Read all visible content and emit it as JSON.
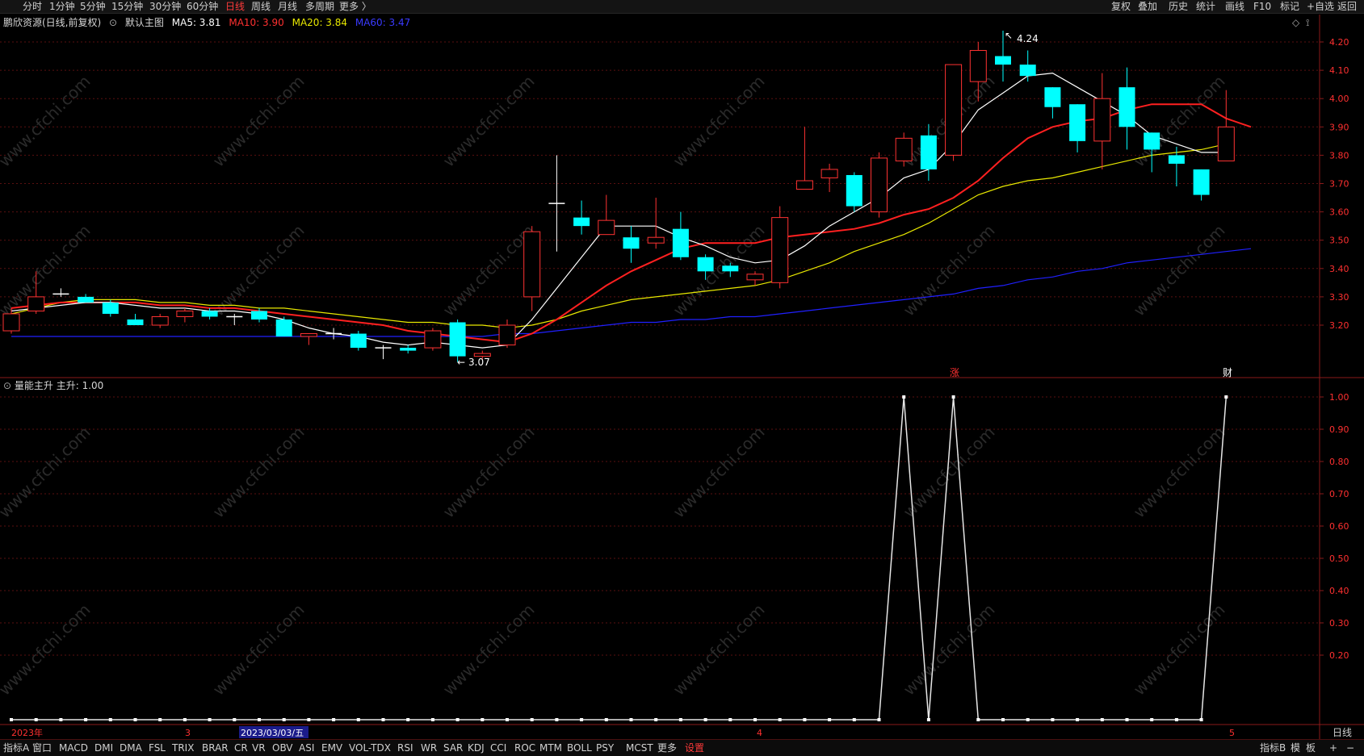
{
  "toolbar": {
    "periods": [
      "分时",
      "1分钟",
      "5分钟",
      "15分钟",
      "30分钟",
      "60分钟",
      "日线",
      "周线",
      "月线",
      "多周期",
      "更多 〉"
    ],
    "active_period": "日线",
    "right_items": [
      "复权",
      "叠加",
      "历史",
      "统计",
      "画线",
      "F10",
      "标记",
      "+自选",
      "返回"
    ]
  },
  "main_legend": {
    "title": "鹏欣资源(日线,前复权)",
    "template": "默认主图",
    "ma5": "MA5: 3.81",
    "ma10": "MA10: 3.90",
    "ma20": "MA20: 3.84",
    "ma60": "MA60: 3.47"
  },
  "sub_legend": {
    "name": "量能主升",
    "value": "主升: 1.00"
  },
  "markers": {
    "high_label": "4.24",
    "low_label": "3.07",
    "zhang": "涨",
    "cai": "财"
  },
  "x_axis": {
    "year_label": "2023年",
    "m3": "3",
    "date_cursor": "2023/03/03/五",
    "m4": "4",
    "m5": "5",
    "period": "日线"
  },
  "bottom_tabs": [
    "指标A",
    "窗口",
    "MACD",
    "DMI",
    "DMA",
    "FSL",
    "TRIX",
    "BRAR",
    "CR",
    "VR",
    "OBV",
    "ASI",
    "EMV",
    "VOL-TDX",
    "RSI",
    "WR",
    "SAR",
    "KDJ",
    "CCI",
    "ROC",
    "MTM",
    "BOLL",
    "PSY",
    "MCST",
    "更多",
    "设置"
  ],
  "bottom_right": [
    "指标B",
    "模",
    "板",
    "+",
    "−"
  ],
  "watermark": "www.cfchi.com",
  "colors": {
    "up": "#ff3232",
    "down": "#00ffff",
    "ma5": "#ffffff",
    "ma10": "#ff2020",
    "ma20": "#e8e800",
    "ma60": "#2020ff",
    "grid": "#5a1010"
  },
  "chart_data": [
    {
      "type": "candlestick",
      "title": "鹏欣资源(日线,前复权)",
      "ylim": [
        3.07,
        4.24
      ],
      "yticks": [
        3.2,
        3.3,
        3.4,
        3.5,
        3.6,
        3.7,
        3.8,
        3.9,
        4.0,
        4.1,
        4.2
      ],
      "candles": [
        {
          "o": 3.18,
          "h": 3.26,
          "l": 3.17,
          "c": 3.24
        },
        {
          "o": 3.25,
          "h": 3.39,
          "l": 3.24,
          "c": 3.3
        },
        {
          "o": 3.31,
          "h": 3.33,
          "l": 3.3,
          "c": 3.31
        },
        {
          "o": 3.3,
          "h": 3.31,
          "l": 3.28,
          "c": 3.28
        },
        {
          "o": 3.28,
          "h": 3.29,
          "l": 3.23,
          "c": 3.24
        },
        {
          "o": 3.22,
          "h": 3.24,
          "l": 3.2,
          "c": 3.2
        },
        {
          "o": 3.2,
          "h": 3.24,
          "l": 3.19,
          "c": 3.23
        },
        {
          "o": 3.23,
          "h": 3.26,
          "l": 3.21,
          "c": 3.25
        },
        {
          "o": 3.25,
          "h": 3.26,
          "l": 3.22,
          "c": 3.23
        },
        {
          "o": 3.23,
          "h": 3.24,
          "l": 3.2,
          "c": 3.23
        },
        {
          "o": 3.25,
          "h": 3.26,
          "l": 3.21,
          "c": 3.22
        },
        {
          "o": 3.22,
          "h": 3.23,
          "l": 3.16,
          "c": 3.16
        },
        {
          "o": 3.16,
          "h": 3.17,
          "l": 3.13,
          "c": 3.17
        },
        {
          "o": 3.17,
          "h": 3.19,
          "l": 3.15,
          "c": 3.17
        },
        {
          "o": 3.17,
          "h": 3.18,
          "l": 3.11,
          "c": 3.12
        },
        {
          "o": 3.12,
          "h": 3.13,
          "l": 3.08,
          "c": 3.12
        },
        {
          "o": 3.12,
          "h": 3.13,
          "l": 3.1,
          "c": 3.11
        },
        {
          "o": 3.12,
          "h": 3.19,
          "l": 3.11,
          "c": 3.18
        },
        {
          "o": 3.21,
          "h": 3.22,
          "l": 3.07,
          "c": 3.09
        },
        {
          "o": 3.09,
          "h": 3.11,
          "l": 3.08,
          "c": 3.1
        },
        {
          "o": 3.13,
          "h": 3.22,
          "l": 3.12,
          "c": 3.2
        },
        {
          "o": 3.3,
          "h": 3.55,
          "l": 3.25,
          "c": 3.53
        },
        {
          "o": 3.63,
          "h": 3.8,
          "l": 3.46,
          "c": 3.63
        },
        {
          "o": 3.58,
          "h": 3.64,
          "l": 3.52,
          "c": 3.55
        },
        {
          "o": 3.52,
          "h": 3.66,
          "l": 3.52,
          "c": 3.57
        },
        {
          "o": 3.51,
          "h": 3.55,
          "l": 3.42,
          "c": 3.47
        },
        {
          "o": 3.49,
          "h": 3.65,
          "l": 3.47,
          "c": 3.51
        },
        {
          "o": 3.54,
          "h": 3.6,
          "l": 3.43,
          "c": 3.44
        },
        {
          "o": 3.44,
          "h": 3.45,
          "l": 3.36,
          "c": 3.39
        },
        {
          "o": 3.41,
          "h": 3.42,
          "l": 3.37,
          "c": 3.39
        },
        {
          "o": 3.36,
          "h": 3.39,
          "l": 3.34,
          "c": 3.38
        },
        {
          "o": 3.35,
          "h": 3.62,
          "l": 3.33,
          "c": 3.58
        },
        {
          "o": 3.68,
          "h": 3.9,
          "l": 3.68,
          "c": 3.71
        },
        {
          "o": 3.72,
          "h": 3.77,
          "l": 3.67,
          "c": 3.75
        },
        {
          "o": 3.73,
          "h": 3.74,
          "l": 3.6,
          "c": 3.62
        },
        {
          "o": 3.6,
          "h": 3.81,
          "l": 3.58,
          "c": 3.79
        },
        {
          "o": 3.78,
          "h": 3.88,
          "l": 3.76,
          "c": 3.86
        },
        {
          "o": 3.87,
          "h": 3.91,
          "l": 3.71,
          "c": 3.75
        },
        {
          "o": 3.8,
          "h": 4.12,
          "l": 3.78,
          "c": 4.12
        },
        {
          "o": 4.06,
          "h": 4.2,
          "l": 3.99,
          "c": 4.17
        },
        {
          "o": 4.15,
          "h": 4.24,
          "l": 4.06,
          "c": 4.12
        },
        {
          "o": 4.12,
          "h": 4.17,
          "l": 4.06,
          "c": 4.08
        },
        {
          "o": 4.04,
          "h": 4.04,
          "l": 3.93,
          "c": 3.97
        },
        {
          "o": 3.98,
          "h": 3.98,
          "l": 3.81,
          "c": 3.85
        },
        {
          "o": 3.85,
          "h": 4.09,
          "l": 3.75,
          "c": 4.0
        },
        {
          "o": 4.04,
          "h": 4.11,
          "l": 3.82,
          "c": 3.9
        },
        {
          "o": 3.88,
          "h": 3.88,
          "l": 3.74,
          "c": 3.82
        },
        {
          "o": 3.8,
          "h": 3.83,
          "l": 3.69,
          "c": 3.77
        },
        {
          "o": 3.75,
          "h": 3.75,
          "l": 3.64,
          "c": 3.66
        },
        {
          "o": 3.78,
          "h": 4.03,
          "l": 3.78,
          "c": 3.9
        }
      ],
      "ma5": [
        3.25,
        3.26,
        3.27,
        3.28,
        3.28,
        3.27,
        3.26,
        3.26,
        3.25,
        3.25,
        3.24,
        3.22,
        3.19,
        3.17,
        3.16,
        3.14,
        3.13,
        3.14,
        3.13,
        3.12,
        3.13,
        3.22,
        3.33,
        3.44,
        3.55,
        3.55,
        3.55,
        3.51,
        3.48,
        3.44,
        3.42,
        3.43,
        3.48,
        3.55,
        3.6,
        3.65,
        3.72,
        3.75,
        3.84,
        3.96,
        4.02,
        4.08,
        4.09,
        4.04,
        3.99,
        3.94,
        3.87,
        3.84,
        3.81,
        3.81
      ],
      "ma10": [
        3.26,
        3.27,
        3.28,
        3.28,
        3.28,
        3.28,
        3.27,
        3.27,
        3.26,
        3.26,
        3.25,
        3.24,
        3.23,
        3.22,
        3.21,
        3.2,
        3.18,
        3.17,
        3.16,
        3.15,
        3.14,
        3.17,
        3.22,
        3.28,
        3.34,
        3.39,
        3.43,
        3.47,
        3.49,
        3.49,
        3.49,
        3.51,
        3.52,
        3.53,
        3.54,
        3.56,
        3.59,
        3.61,
        3.65,
        3.71,
        3.79,
        3.86,
        3.9,
        3.92,
        3.93,
        3.96,
        3.98,
        3.98,
        3.98,
        3.93,
        3.9
      ],
      "ma20": [
        3.24,
        3.26,
        3.28,
        3.29,
        3.29,
        3.29,
        3.28,
        3.28,
        3.27,
        3.27,
        3.26,
        3.26,
        3.25,
        3.24,
        3.23,
        3.22,
        3.21,
        3.21,
        3.2,
        3.2,
        3.19,
        3.2,
        3.22,
        3.25,
        3.27,
        3.29,
        3.3,
        3.31,
        3.32,
        3.33,
        3.34,
        3.36,
        3.39,
        3.42,
        3.46,
        3.49,
        3.52,
        3.56,
        3.61,
        3.66,
        3.69,
        3.71,
        3.72,
        3.74,
        3.76,
        3.78,
        3.8,
        3.81,
        3.82,
        3.84
      ],
      "ma60": [
        3.16,
        3.16,
        3.16,
        3.16,
        3.16,
        3.16,
        3.16,
        3.16,
        3.16,
        3.16,
        3.16,
        3.16,
        3.16,
        3.16,
        3.16,
        3.16,
        3.16,
        3.16,
        3.16,
        3.16,
        3.17,
        3.17,
        3.18,
        3.19,
        3.2,
        3.21,
        3.21,
        3.22,
        3.22,
        3.23,
        3.23,
        3.24,
        3.25,
        3.26,
        3.27,
        3.28,
        3.29,
        3.3,
        3.31,
        3.33,
        3.34,
        3.36,
        3.37,
        3.39,
        3.4,
        3.42,
        3.43,
        3.44,
        3.45,
        3.46,
        3.47
      ]
    },
    {
      "type": "line",
      "title": "量能主升",
      "series": [
        {
          "name": "主升",
          "values": [
            0,
            0,
            0,
            0,
            0,
            0,
            0,
            0,
            0,
            0,
            0,
            0,
            0,
            0,
            0,
            0,
            0,
            0,
            0,
            0,
            0,
            0,
            0,
            0,
            0,
            0,
            0,
            0,
            0,
            0,
            0,
            0,
            0,
            0,
            0,
            0,
            1,
            0,
            1,
            0,
            0,
            0,
            0,
            0,
            0,
            0,
            0,
            0,
            0,
            1
          ]
        }
      ],
      "ylim": [
        0,
        1.0
      ],
      "yticks": [
        0.2,
        0.3,
        0.4,
        0.5,
        0.6,
        0.7,
        0.8,
        0.9,
        1.0
      ]
    }
  ]
}
